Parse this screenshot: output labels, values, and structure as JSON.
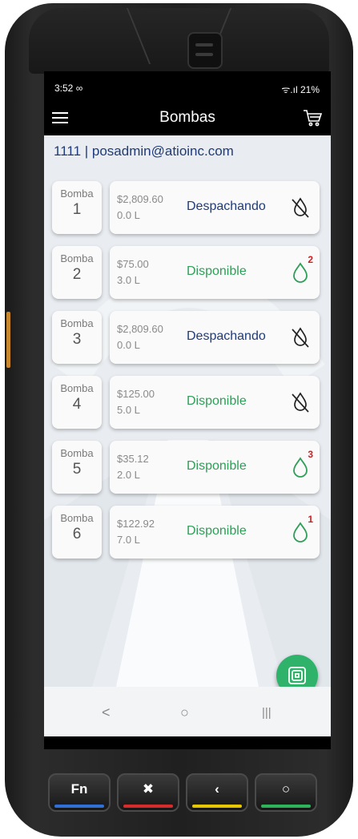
{
  "status_bar": {
    "time": "3:52 ∞",
    "right": "ᯤ.ıl 21%"
  },
  "app_bar": {
    "title": "Bombas",
    "menu_icon": "hamburger-menu-icon",
    "cart_icon": "shopping-cart-icon"
  },
  "user_line": "1111 | posadmin@atioinc.com",
  "pumps": [
    {
      "label": "Bomba",
      "number": "1",
      "amount": "$2,809.60",
      "volume": "0.0 L",
      "status": "Despachando",
      "status_type": "despachando",
      "icon": "no-fuel-drop-icon",
      "badge": ""
    },
    {
      "label": "Bomba",
      "number": "2",
      "amount": "$75.00",
      "volume": "3.0 L",
      "status": "Disponible",
      "status_type": "disponible",
      "icon": "fuel-drop-icon",
      "badge": "2"
    },
    {
      "label": "Bomba",
      "number": "3",
      "amount": "$2,809.60",
      "volume": "0.0 L",
      "status": "Despachando",
      "status_type": "despachando",
      "icon": "no-fuel-drop-icon",
      "badge": ""
    },
    {
      "label": "Bomba",
      "number": "4",
      "amount": "$125.00",
      "volume": "5.0 L",
      "status": "Disponible",
      "status_type": "disponible",
      "icon": "no-fuel-drop-icon",
      "badge": ""
    },
    {
      "label": "Bomba",
      "number": "5",
      "amount": "$35.12",
      "volume": "2.0 L",
      "status": "Disponible",
      "status_type": "disponible",
      "icon": "fuel-drop-icon",
      "badge": "3"
    },
    {
      "label": "Bomba",
      "number": "6",
      "amount": "$122.92",
      "volume": "7.0 L",
      "status": "Disponible",
      "status_type": "disponible",
      "icon": "fuel-drop-icon",
      "badge": "1"
    }
  ],
  "fab": {
    "icon": "nfc-card-icon"
  },
  "nav_bar": {
    "back": "<",
    "home": "○",
    "recents": "|||"
  },
  "hardware_keys": [
    {
      "label": "Fn",
      "color": "#2f6fd6"
    },
    {
      "label": "✖",
      "color": "#d62b2b"
    },
    {
      "label": "‹",
      "color": "#e5c600"
    },
    {
      "label": "○",
      "color": "#2fb35a"
    }
  ],
  "colors": {
    "disponible": "#2e9e58",
    "despachando": "#1f3b7a",
    "badge": "#d21d1d",
    "fab": "#2fb36a"
  }
}
